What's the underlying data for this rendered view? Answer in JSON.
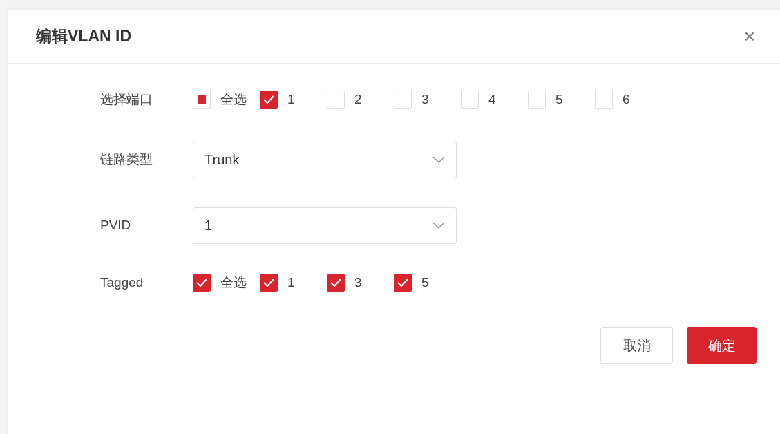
{
  "dialog": {
    "title": "编辑VLAN ID",
    "close": "×"
  },
  "fields": [
    {
      "kind": "checkboxes",
      "label": "选择端口",
      "options": [
        {
          "label": "全选",
          "checked": false,
          "indeterminate": true
        },
        {
          "label": "1",
          "checked": true,
          "indeterminate": false
        },
        {
          "label": "2",
          "checked": false,
          "indeterminate": false
        },
        {
          "label": "3",
          "checked": false,
          "indeterminate": false
        },
        {
          "label": "4",
          "checked": false,
          "indeterminate": false
        },
        {
          "label": "5",
          "checked": false,
          "indeterminate": false
        },
        {
          "label": "6",
          "checked": false,
          "indeterminate": false
        }
      ]
    },
    {
      "kind": "select",
      "label": "链路类型",
      "value": "Trunk"
    },
    {
      "kind": "select",
      "label": "PVID",
      "value": "1"
    },
    {
      "kind": "checkboxes",
      "label": "Tagged",
      "options": [
        {
          "label": "全选",
          "checked": true,
          "indeterminate": false
        },
        {
          "label": "1",
          "checked": true,
          "indeterminate": false
        },
        {
          "label": "3",
          "checked": true,
          "indeterminate": false
        },
        {
          "label": "5",
          "checked": true,
          "indeterminate": false
        }
      ]
    }
  ],
  "buttons": [
    {
      "label": "取消",
      "kind": "secondary"
    },
    {
      "label": "确定",
      "kind": "primary"
    }
  ]
}
